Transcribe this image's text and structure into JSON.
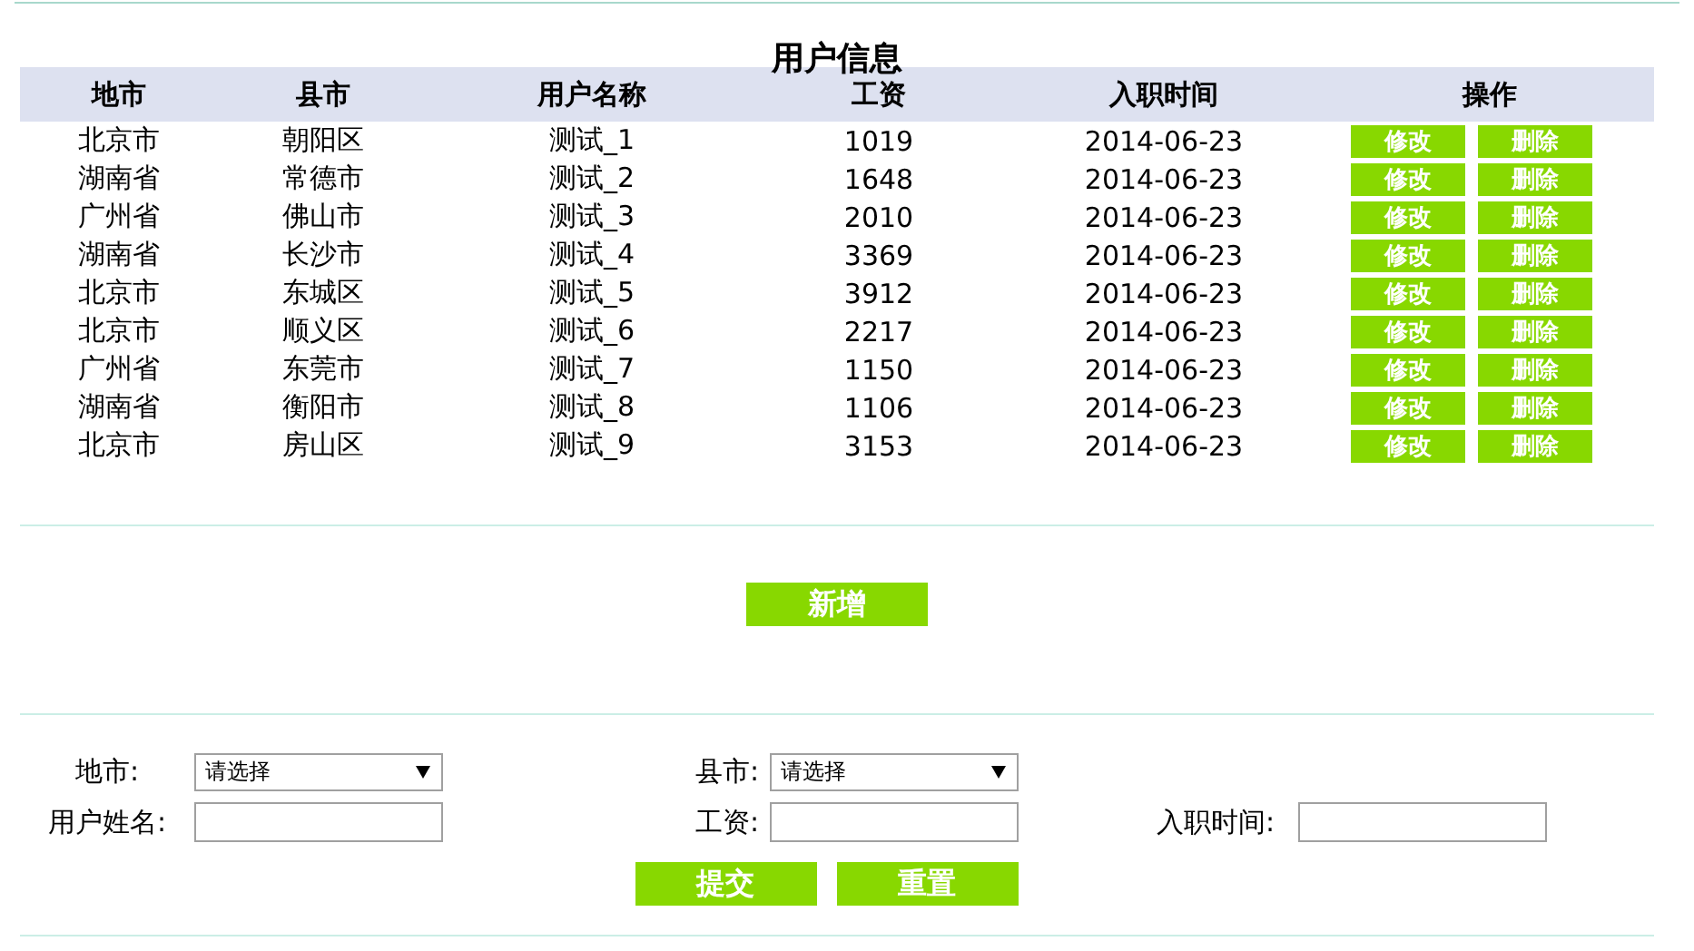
{
  "title": "用户信息",
  "table": {
    "columns": [
      "地市",
      "县市",
      "用户名称",
      "工资",
      "入职时间",
      "操作"
    ],
    "rows": [
      {
        "cells": [
          "北京市",
          "朝阳区",
          "测试_1",
          "1019",
          "2014-06-23"
        ],
        "actions": [
          "修改",
          "删除"
        ]
      },
      {
        "cells": [
          "湖南省",
          "常德市",
          "测试_2",
          "1648",
          "2014-06-23"
        ],
        "actions": [
          "修改",
          "删除"
        ]
      },
      {
        "cells": [
          "广州省",
          "佛山市",
          "测试_3",
          "2010",
          "2014-06-23"
        ],
        "actions": [
          "修改",
          "删除"
        ]
      },
      {
        "cells": [
          "湖南省",
          "长沙市",
          "测试_4",
          "3369",
          "2014-06-23"
        ],
        "actions": [
          "修改",
          "删除"
        ]
      },
      {
        "cells": [
          "北京市",
          "东城区",
          "测试_5",
          "3912",
          "2014-06-23"
        ],
        "actions": [
          "修改",
          "删除"
        ]
      },
      {
        "cells": [
          "北京市",
          "顺义区",
          "测试_6",
          "2217",
          "2014-06-23"
        ],
        "actions": [
          "修改",
          "删除"
        ]
      },
      {
        "cells": [
          "广州省",
          "东莞市",
          "测试_7",
          "1150",
          "2014-06-23"
        ],
        "actions": [
          "修改",
          "删除"
        ]
      },
      {
        "cells": [
          "湖南省",
          "衡阳市",
          "测试_8",
          "1106",
          "2014-06-23"
        ],
        "actions": [
          "修改",
          "删除"
        ]
      },
      {
        "cells": [
          "北京市",
          "房山区",
          "测试_9",
          "3153",
          "2014-06-23"
        ],
        "actions": [
          "修改",
          "删除"
        ]
      }
    ]
  },
  "add_button": "新增",
  "form": {
    "fields": [
      {
        "kind": "select",
        "label": "地市:",
        "value": "请选择"
      },
      {
        "kind": "select",
        "label": "县市:",
        "value": "请选择"
      },
      {
        "kind": "spacer"
      },
      {
        "kind": "text",
        "label": "用户姓名:"
      },
      {
        "kind": "text",
        "label": "工资:"
      },
      {
        "kind": "text",
        "label": "入职时间:"
      }
    ],
    "buttons": [
      "提交",
      "重置"
    ]
  }
}
